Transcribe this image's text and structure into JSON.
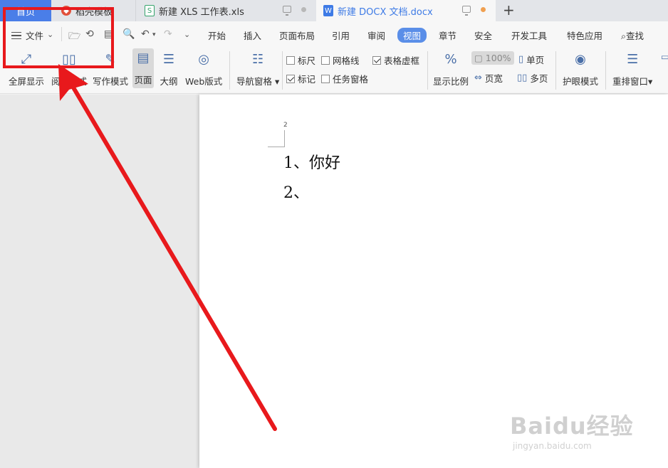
{
  "tabs": {
    "home": "首页",
    "template": "稻壳模板",
    "xls": "新建 XLS 工作表.xls",
    "docx": "新建 DOCX 文档.docx",
    "new_tab": "+"
  },
  "menu": {
    "file": "文件",
    "items": [
      "开始",
      "插入",
      "页面布局",
      "引用",
      "审阅",
      "视图",
      "章节",
      "安全",
      "开发工具",
      "特色应用"
    ],
    "active": "视图",
    "search": "查找"
  },
  "ribbon": {
    "fullscreen": "全屏显示",
    "reading": "阅读版式",
    "writing": "写作模式",
    "page": "页面",
    "outline": "大纲",
    "web": "Web版式",
    "nav_pane": "导航窗格",
    "ruler": "标尺",
    "gridlines": "网格线",
    "table_gridlines": "表格虚框",
    "marks": "标记",
    "task_pane": "任务窗格",
    "zoom": "显示比例",
    "zoom_value": "100%",
    "page_width": "页宽",
    "single_page": "单页",
    "multi_page": "多页",
    "eye_mode": "护眼模式",
    "arrange": "重排窗口",
    "checks": {
      "ruler": false,
      "gridlines": false,
      "table_gridlines": true,
      "marks": true,
      "task_pane": false
    }
  },
  "document": {
    "page_number": "2",
    "lines": [
      "1、你好",
      "2、"
    ]
  },
  "watermark": {
    "brand": "Baidu经验",
    "url": "jingyan.baidu.com"
  },
  "colors": {
    "accent": "#4a7ee8",
    "annotation": "#e8191c"
  }
}
